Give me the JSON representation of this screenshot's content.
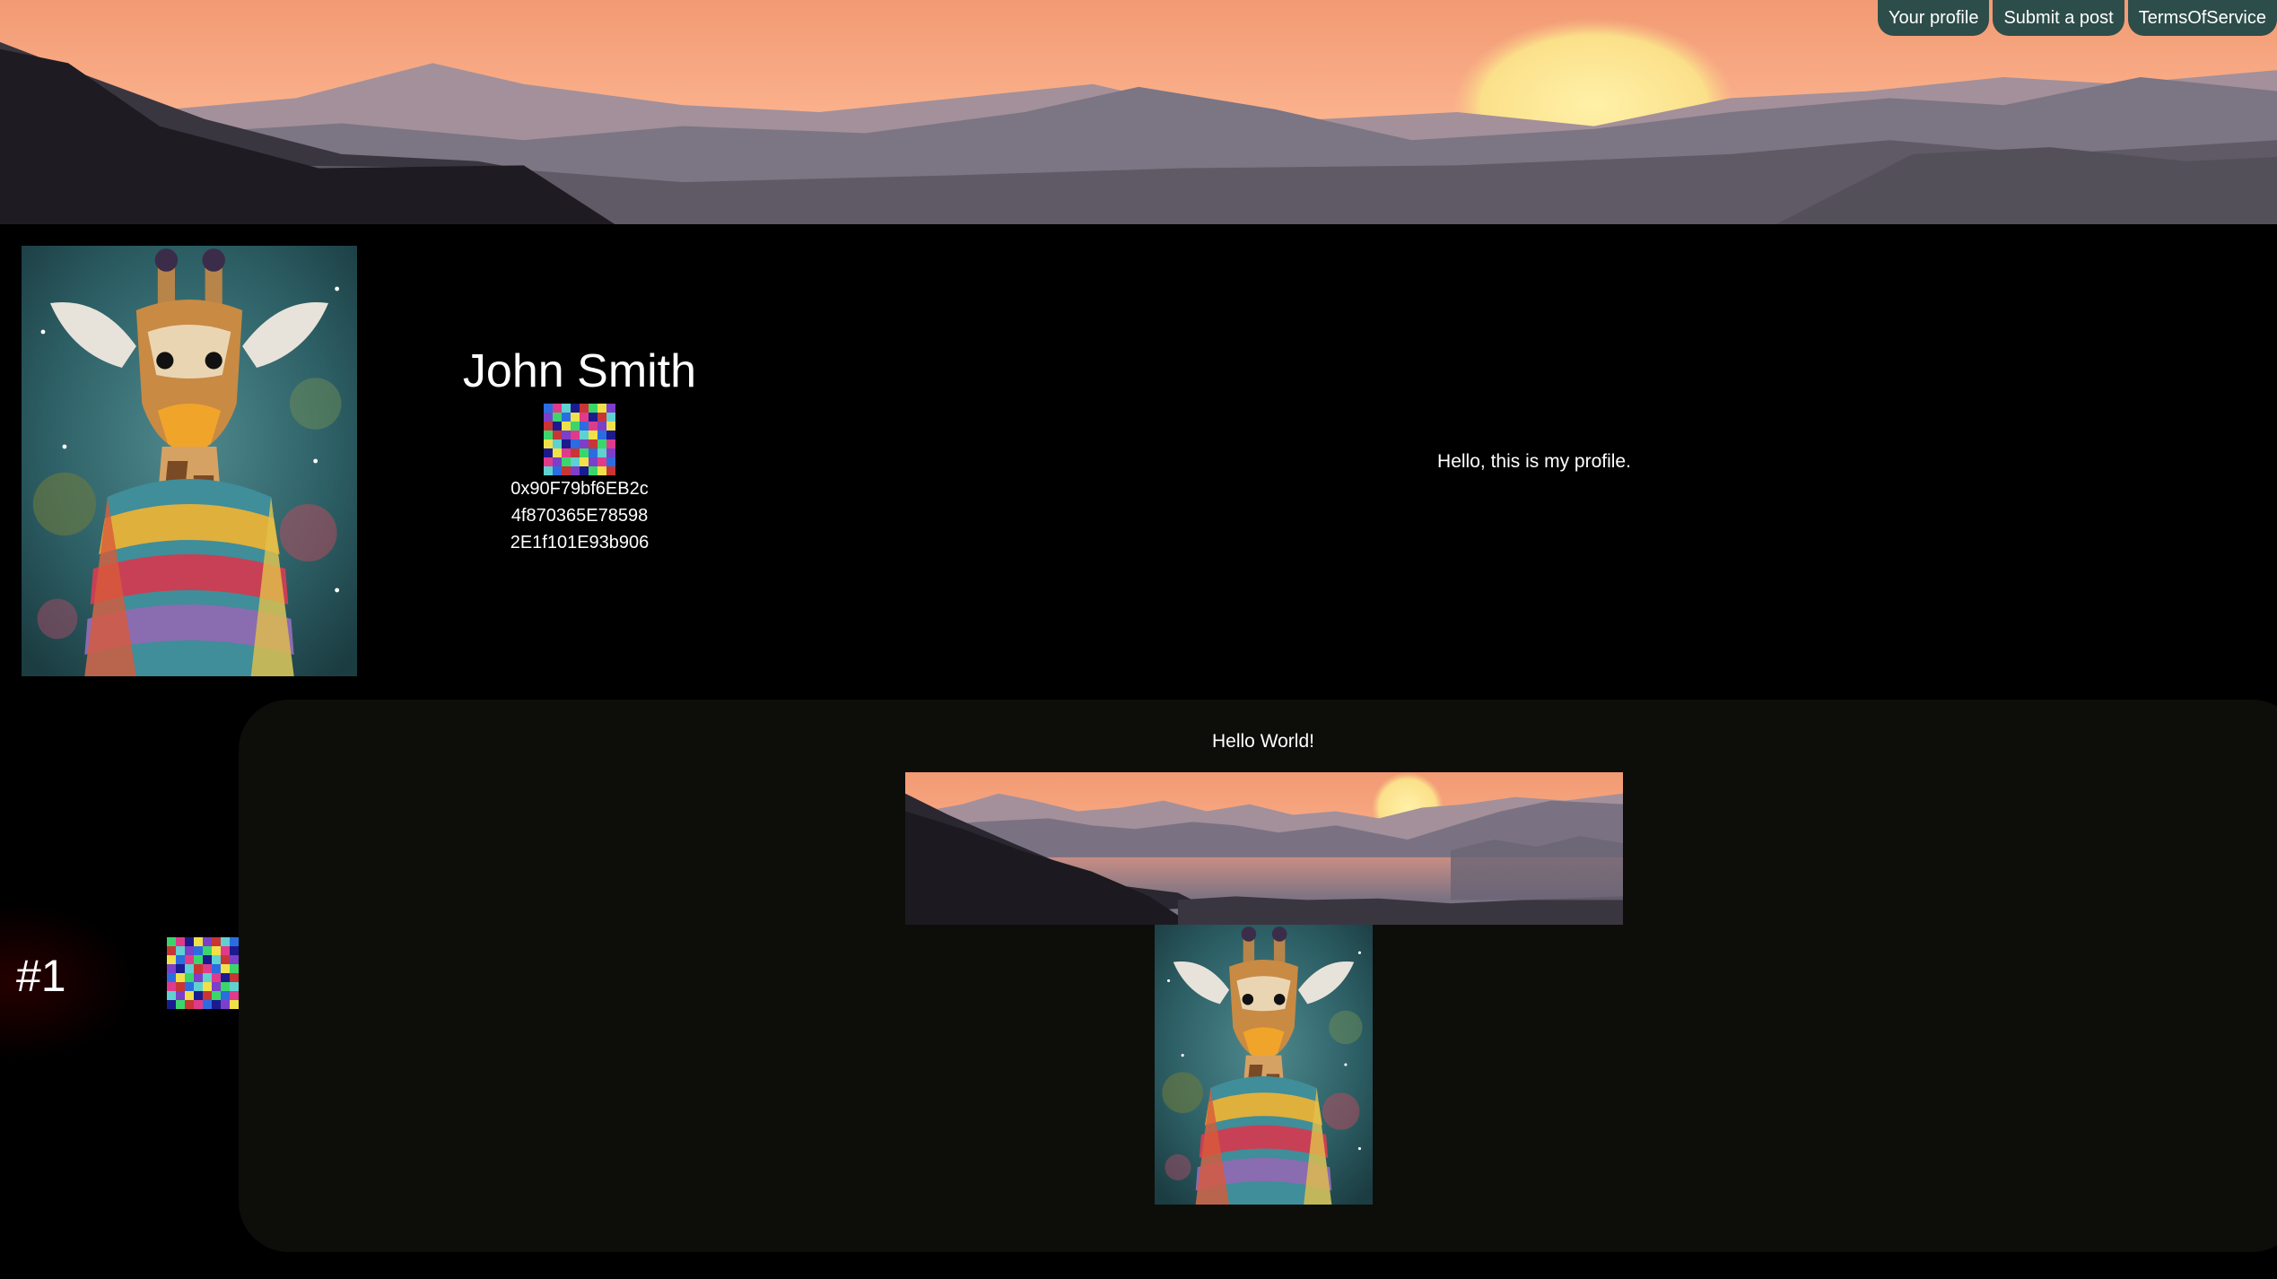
{
  "nav": {
    "your_profile": "Your profile",
    "submit_post": "Submit a post",
    "terms": "TermsOfService"
  },
  "profile": {
    "name": "John Smith",
    "address_lines": [
      "0x90F79bf6EB2c",
      "4f870365E78598",
      "2E1f101E93b906"
    ],
    "bio": "Hello, this is my profile.",
    "banner_image": "mountain-sunset-banner",
    "avatar_image": "giraffe-with-scarf-painting"
  },
  "post": {
    "rank": "#1",
    "title": "Hello World!",
    "images": [
      "mountain-sunset-banner",
      "giraffe-with-scarf-painting"
    ]
  },
  "colors": {
    "page_background": "#000000",
    "nav_button": "#2d4d4a",
    "post_card": "#0d0e0a"
  }
}
